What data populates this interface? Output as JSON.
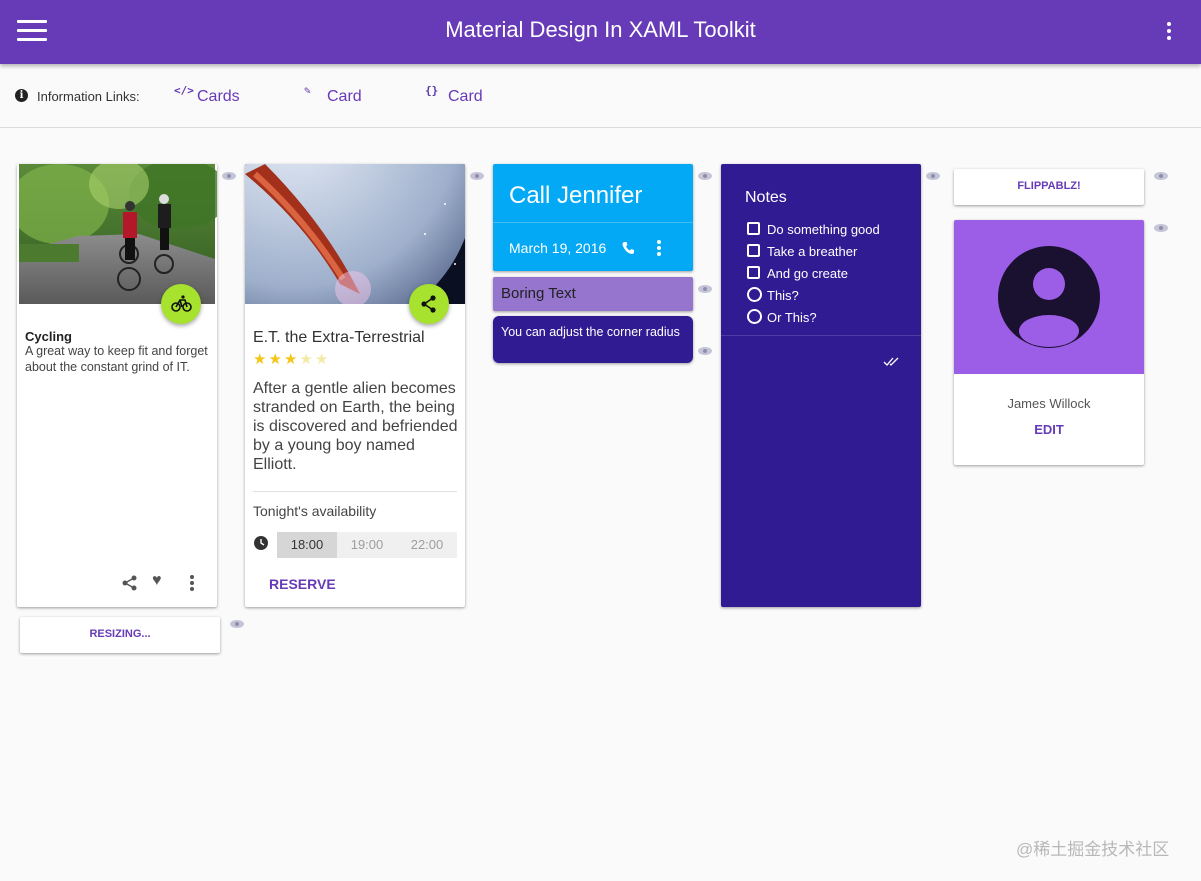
{
  "app": {
    "title": "Material Design In XAML Toolkit"
  },
  "links": {
    "label": "Information Links:",
    "items": [
      {
        "icon": "</>",
        "label": "Cards"
      },
      {
        "icon": "✎",
        "label": "Card"
      },
      {
        "icon": "{}",
        "label": "Card"
      }
    ]
  },
  "cycling": {
    "title": "Cycling",
    "description": "A great way to keep fit and forget about the constant grind of IT."
  },
  "resizing": {
    "label": "RESIZING..."
  },
  "movie": {
    "title": "E.T. the Extra-Terrestrial",
    "rating": 3,
    "rating_max": 5,
    "description": "After a gentle alien becomes stranded on Earth, the being is discovered and befriended by a young boy named Elliott.",
    "availability_label": "Tonight's availability",
    "times": [
      "18:00",
      "19:00",
      "22:00"
    ],
    "reserve_label": "RESERVE"
  },
  "call": {
    "title": "Call Jennifer",
    "date": "March 19, 2016"
  },
  "boring": {
    "text": "Boring Text"
  },
  "corner": {
    "text": "You can adjust the corner radius"
  },
  "notes": {
    "title": "Notes",
    "checks": [
      "Do something good",
      "Take a breather",
      "And go create"
    ],
    "radios": [
      "This?",
      "Or This?"
    ]
  },
  "flip": {
    "label": "FLIPPABLZ!"
  },
  "profile": {
    "name": "James Willock",
    "edit_label": "EDIT"
  },
  "watermark": {
    "text": "@稀土掘金技术社区"
  },
  "colors": {
    "primary": "#673ab7",
    "accent_fab": "#a6e22e",
    "call_card": "#03a9f4",
    "boring_card": "#9575cd",
    "dark_card": "#311b92",
    "profile_bg": "#9c5ee6"
  }
}
